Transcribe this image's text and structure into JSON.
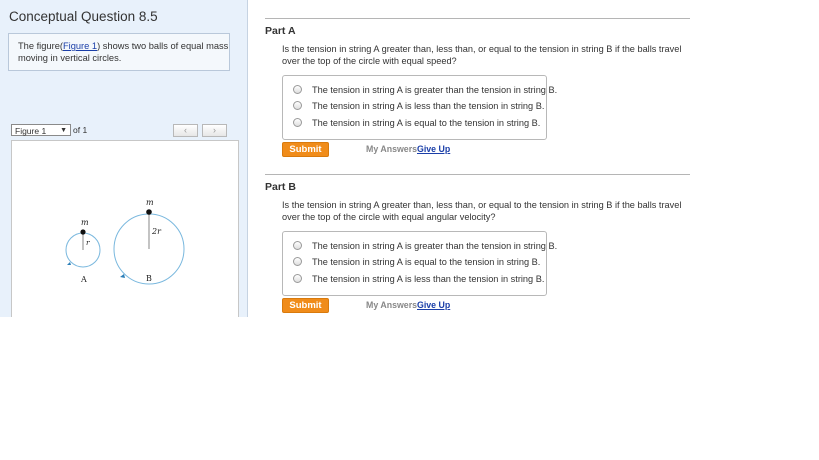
{
  "question": {
    "title": "Conceptual Question 8.5",
    "intro_prefix": "The figure(",
    "intro_link": "Figure 1",
    "intro_suffix": ") shows two balls of equal mass moving in vertical circles."
  },
  "figure": {
    "select_value": "Figure 1",
    "of_label": "of 1",
    "prev_icon": "chevron-left-icon",
    "next_icon": "chevron-right-icon",
    "labels": {
      "mass_a": "m",
      "radius_a": "r",
      "name_a": "A",
      "mass_b": "m",
      "radius_b": "2r",
      "name_b": "B"
    }
  },
  "parts": [
    {
      "heading": "Part A",
      "question": "Is the tension in string A greater than, less than, or equal to the tension in string B if the balls travel over the top of the circle with equal speed?",
      "options": [
        "The tension in string A is greater than the tension in string B.",
        "The tension in string A is less than the tension in string B.",
        "The tension in string A is equal to the tension in string B."
      ],
      "submit": "Submit",
      "my_answers": "My Answers",
      "give_up": "Give Up"
    },
    {
      "heading": "Part B",
      "question": "Is the tension in string A greater than, less than, or equal to the tension in string B if the balls travel over the top of the circle with equal angular velocity?",
      "options": [
        "The tension in string A is greater than the tension in string B.",
        "The tension in string A is equal to the tension in string B.",
        "The tension in string A is less than the tension in string B."
      ],
      "submit": "Submit",
      "my_answers": "My Answers",
      "give_up": "Give Up"
    }
  ],
  "colors": {
    "submit": "#f08c1a",
    "link": "#1a3ea8",
    "circle": "#7ab8de",
    "left_panel": "#e8f1fb"
  }
}
